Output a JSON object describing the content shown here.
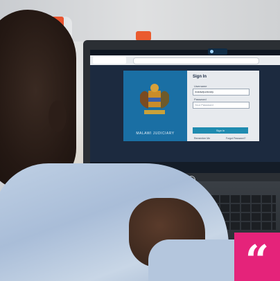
{
  "browser": {
    "tab_title": ""
  },
  "login": {
    "title": "Sign In",
    "username_label": "Username",
    "username_value": "malawijudiciary",
    "password_label": "Password",
    "password_placeholder": "Your Password",
    "signin_button": "Sign in",
    "remember_label": "Remember Me",
    "forgot_label": "Forgot Password?"
  },
  "brand": {
    "text": "MALAWI JUDICIARY"
  },
  "badge": {
    "symbol": "“"
  },
  "colors": {
    "badge": "#e5237a",
    "brand_panel": "#1a6fa4",
    "button": "#1f8bb0"
  }
}
